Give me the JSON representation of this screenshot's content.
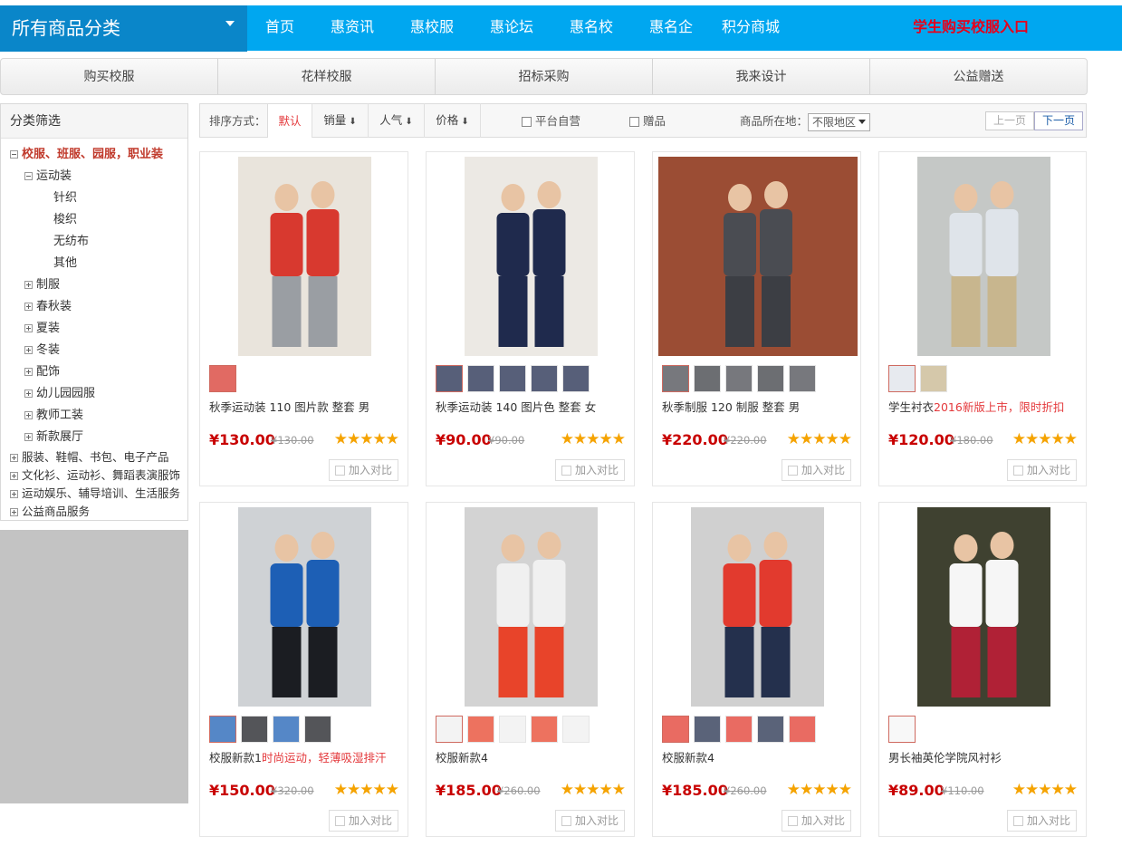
{
  "nav": {
    "all_categories": "所有商品分类",
    "links": [
      "首页",
      "惠资讯",
      "惠校服",
      "惠论坛",
      "惠名校",
      "惠名企",
      "积分商城"
    ],
    "student_entry": "学生购买校服入口"
  },
  "subtabs": [
    "购买校服",
    "花样校服",
    "招标采购",
    "我来设计",
    "公益赠送"
  ],
  "sidebar": {
    "title": "分类筛选",
    "tree": [
      {
        "label": "校服、班服、园服，职业装",
        "level": 0,
        "state": "minus",
        "highlight": true
      },
      {
        "label": "运动装",
        "level": 1,
        "state": "minus"
      },
      {
        "label": "针织",
        "level": 2,
        "state": "none"
      },
      {
        "label": "梭织",
        "level": 2,
        "state": "none"
      },
      {
        "label": "无纺布",
        "level": 2,
        "state": "none"
      },
      {
        "label": "其他",
        "level": 2,
        "state": "none"
      },
      {
        "label": "制服",
        "level": 1,
        "state": "plus"
      },
      {
        "label": "春秋装",
        "level": 1,
        "state": "plus"
      },
      {
        "label": "夏装",
        "level": 1,
        "state": "plus"
      },
      {
        "label": "冬装",
        "level": 1,
        "state": "plus"
      },
      {
        "label": "配饰",
        "level": 1,
        "state": "plus"
      },
      {
        "label": "幼儿园园服",
        "level": 1,
        "state": "plus"
      },
      {
        "label": "教师工装",
        "level": 1,
        "state": "plus"
      },
      {
        "label": "新款展厅",
        "level": 1,
        "state": "plus"
      },
      {
        "label": "服装、鞋帽、书包、电子产品",
        "level": 0,
        "state": "plus"
      },
      {
        "label": "文化衫、运动衫、舞蹈表演服饰",
        "level": 0,
        "state": "plus"
      },
      {
        "label": "运动娱乐、辅导培训、生活服务",
        "level": 0,
        "state": "plus"
      },
      {
        "label": "公益商品服务",
        "level": 0,
        "state": "plus"
      }
    ]
  },
  "sortbar": {
    "label": "排序方式：",
    "tabs": [
      {
        "label": "默认",
        "arrow": ""
      },
      {
        "label": "销量",
        "arrow": "🠗"
      },
      {
        "label": "人气",
        "arrow": "🠗"
      },
      {
        "label": "价格",
        "arrow": "🠗"
      }
    ],
    "self_operated": "平台自营",
    "gift": "赠品",
    "region_label": "商品所在地：",
    "region_value": "不限地区",
    "prev": "上一页",
    "next": "下一页"
  },
  "products": [
    {
      "title": "秋季运动装 110 图片款 整套 男",
      "promo": "",
      "price": "¥130.00",
      "old_price": "¥130.00",
      "stars": "★★★★★",
      "compare": "加入对比",
      "thumbs": 1,
      "img_color": "#e9e4dc",
      "cloth": "#d8392f",
      "pants": "#9a9ea3",
      "bg_wide": false
    },
    {
      "title": "秋季运动装 140 图片色 整套 女",
      "promo": "",
      "price": "¥90.00",
      "old_price": "¥90.00",
      "stars": "★★★★★",
      "compare": "加入对比",
      "thumbs": 5,
      "img_color": "#ece9e4",
      "cloth": "#1f2a4d",
      "pants": "#1f2a4d",
      "bg_wide": false
    },
    {
      "title": "秋季制服 120 制服 整套 男",
      "promo": "",
      "price": "¥220.00",
      "old_price": "¥220.00",
      "stars": "★★★★★",
      "compare": "加入对比",
      "thumbs": 5,
      "img_color": "#9b4d34",
      "cloth": "#4a4c52",
      "pants": "#3c3e44",
      "bg_wide": true
    },
    {
      "title": "学生衬衣",
      "promo": "2016新版上市，限时折扣",
      "price": "¥120.00",
      "old_price": "¥180.00",
      "stars": "★★★★★",
      "compare": "加入对比",
      "thumbs": 2,
      "img_color": "#c5c8c6",
      "cloth": "#dfe4ea",
      "pants": "#c8b68e",
      "bg_wide": false
    },
    {
      "title": "校服新款1",
      "promo": "时尚运动，轻薄吸湿排汗",
      "price": "¥150.00",
      "old_price": "¥320.00",
      "stars": "★★★★★",
      "compare": "加入对比",
      "thumbs": 4,
      "img_color": "#cfd2d5",
      "cloth": "#1d5fb5",
      "pants": "#1b1d22",
      "bg_wide": false
    },
    {
      "title": "校服新款4",
      "promo": "",
      "price": "¥185.00",
      "old_price": "¥260.00",
      "stars": "★★★★★",
      "compare": "加入对比",
      "thumbs": 5,
      "img_color": "#d3d3d3",
      "cloth": "#f0f0f0",
      "pants": "#e8442a",
      "bg_wide": false
    },
    {
      "title": "校服新款4",
      "promo": "",
      "price": "¥185.00",
      "old_price": "¥260.00",
      "stars": "★★★★★",
      "compare": "加入对比",
      "thumbs": 5,
      "img_color": "#d0d0d0",
      "cloth": "#e23a2e",
      "pants": "#24304d",
      "bg_wide": false
    },
    {
      "title": "男长袖英伦学院风衬衫",
      "promo": "",
      "price": "¥89.00",
      "old_price": "¥110.00",
      "stars": "★★★★★",
      "compare": "加入对比",
      "thumbs": 1,
      "img_color": "#3f4130",
      "cloth": "#f6f6f6",
      "pants": "#b02136",
      "bg_wide": false
    }
  ],
  "colors": {
    "nav_bg": "#00a7f0",
    "allcat_bg": "#0a86c9",
    "price_red": "#c80000",
    "star": "#f5a300",
    "student_red": "#e8001a"
  }
}
